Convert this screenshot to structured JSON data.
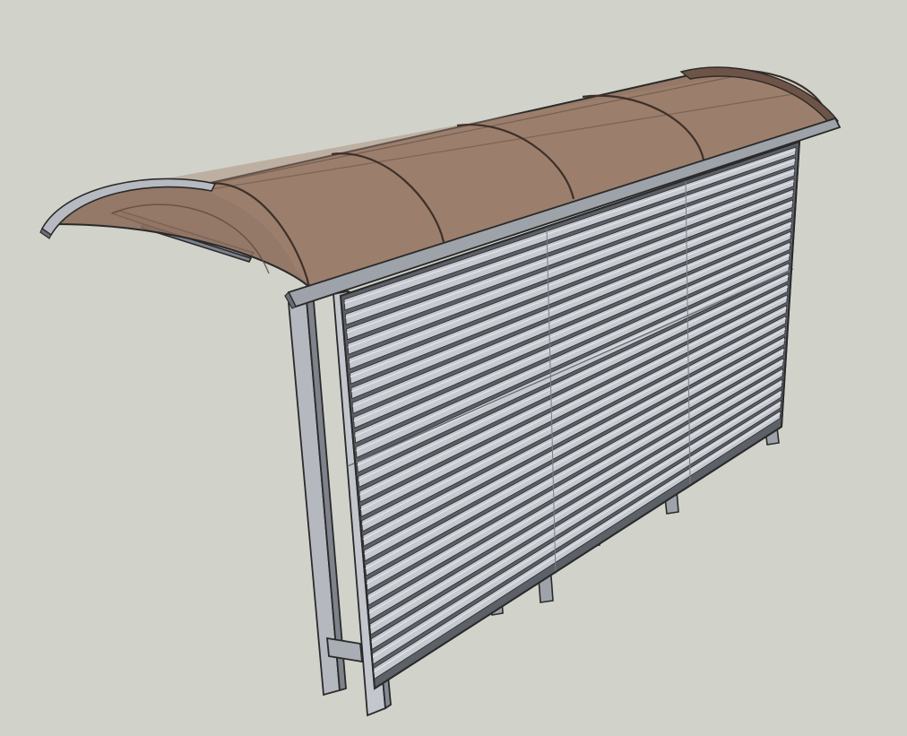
{
  "scene": {
    "subject": "shelter-model",
    "colors": {
      "background": "#d1d3cb",
      "roof": "#8b6c5a",
      "roof_light": "#a78572",
      "roof_dark": "#5f4a3d",
      "metal_light": "#c6c9d0",
      "metal_mid": "#9ea2a9",
      "metal_dark": "#6a6e75",
      "outline": "#2a2a2a"
    },
    "slat_count": 26
  }
}
